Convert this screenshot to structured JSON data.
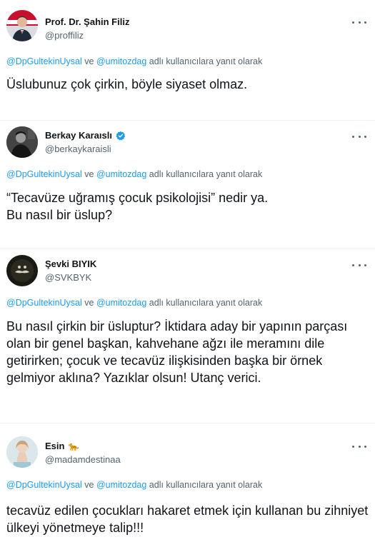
{
  "replying_to": {
    "user1": "@DpGultekinUysal",
    "connector": " ve ",
    "user2": "@umitozdag",
    "suffix": " adlı kullanıcılara yanıt olarak"
  },
  "tweets": [
    {
      "name": "Prof. Dr. Şahin Filiz",
      "handle": "@proffiliz",
      "text": "Üslubunuz çok çirkin, böyle siyaset olmaz.",
      "avatar": "man-in-suit-with-flag",
      "verified": false
    },
    {
      "name": "Berkay Karaıslı",
      "handle": "@berkaykaraisli",
      "text": "“Tecavüze uğramış çocuk psikolojisi” nedir ya.\nBu nasıl bir üslup?",
      "avatar": "dark-portrait",
      "verified": true,
      "verified_color": "#1d9bf0"
    },
    {
      "name": "Şevki BIYIK",
      "handle": "@SVKBYK",
      "text": "Bu nasıl çirkin bir üsluptur? İktidara aday bir yapının parçası olan bir genel başkan, kahvehane ağzı ile meramını dile getirirken; çocuk ve tecavüz ilişkisinden başka bir örnek gelmiyor aklına? Yazıklar olsun! Utanç verici.",
      "avatar": "dark-mustache",
      "verified": false
    },
    {
      "name": "Esin",
      "handle": "@madamdestinaa",
      "text": "tecavüz edilen çocukları hakaret etmek için kullanan bu zihniyet ülkeyi yönetmeye talip!!!",
      "avatar": "woman-photo",
      "verified": false,
      "name_emoji": "🐆"
    }
  ],
  "colors": {
    "link": "#1d9bf0",
    "secondary": "#536471",
    "text": "#0f1419"
  }
}
